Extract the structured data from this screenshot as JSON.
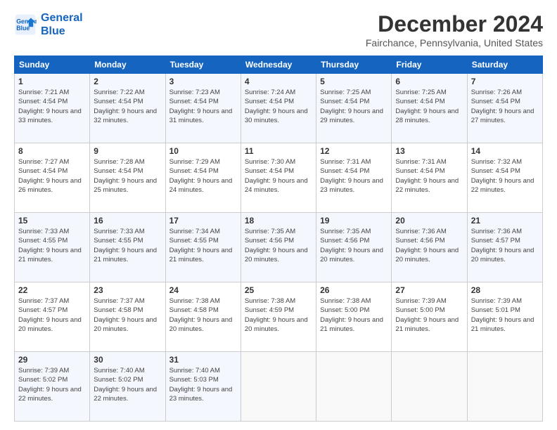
{
  "logo": {
    "line1": "General",
    "line2": "Blue"
  },
  "title": "December 2024",
  "subtitle": "Fairchance, Pennsylvania, United States",
  "days_of_week": [
    "Sunday",
    "Monday",
    "Tuesday",
    "Wednesday",
    "Thursday",
    "Friday",
    "Saturday"
  ],
  "weeks": [
    [
      {
        "day": "1",
        "sunrise": "Sunrise: 7:21 AM",
        "sunset": "Sunset: 4:54 PM",
        "daylight": "Daylight: 9 hours and 33 minutes."
      },
      {
        "day": "2",
        "sunrise": "Sunrise: 7:22 AM",
        "sunset": "Sunset: 4:54 PM",
        "daylight": "Daylight: 9 hours and 32 minutes."
      },
      {
        "day": "3",
        "sunrise": "Sunrise: 7:23 AM",
        "sunset": "Sunset: 4:54 PM",
        "daylight": "Daylight: 9 hours and 31 minutes."
      },
      {
        "day": "4",
        "sunrise": "Sunrise: 7:24 AM",
        "sunset": "Sunset: 4:54 PM",
        "daylight": "Daylight: 9 hours and 30 minutes."
      },
      {
        "day": "5",
        "sunrise": "Sunrise: 7:25 AM",
        "sunset": "Sunset: 4:54 PM",
        "daylight": "Daylight: 9 hours and 29 minutes."
      },
      {
        "day": "6",
        "sunrise": "Sunrise: 7:25 AM",
        "sunset": "Sunset: 4:54 PM",
        "daylight": "Daylight: 9 hours and 28 minutes."
      },
      {
        "day": "7",
        "sunrise": "Sunrise: 7:26 AM",
        "sunset": "Sunset: 4:54 PM",
        "daylight": "Daylight: 9 hours and 27 minutes."
      }
    ],
    [
      {
        "day": "8",
        "sunrise": "Sunrise: 7:27 AM",
        "sunset": "Sunset: 4:54 PM",
        "daylight": "Daylight: 9 hours and 26 minutes."
      },
      {
        "day": "9",
        "sunrise": "Sunrise: 7:28 AM",
        "sunset": "Sunset: 4:54 PM",
        "daylight": "Daylight: 9 hours and 25 minutes."
      },
      {
        "day": "10",
        "sunrise": "Sunrise: 7:29 AM",
        "sunset": "Sunset: 4:54 PM",
        "daylight": "Daylight: 9 hours and 24 minutes."
      },
      {
        "day": "11",
        "sunrise": "Sunrise: 7:30 AM",
        "sunset": "Sunset: 4:54 PM",
        "daylight": "Daylight: 9 hours and 24 minutes."
      },
      {
        "day": "12",
        "sunrise": "Sunrise: 7:31 AM",
        "sunset": "Sunset: 4:54 PM",
        "daylight": "Daylight: 9 hours and 23 minutes."
      },
      {
        "day": "13",
        "sunrise": "Sunrise: 7:31 AM",
        "sunset": "Sunset: 4:54 PM",
        "daylight": "Daylight: 9 hours and 22 minutes."
      },
      {
        "day": "14",
        "sunrise": "Sunrise: 7:32 AM",
        "sunset": "Sunset: 4:54 PM",
        "daylight": "Daylight: 9 hours and 22 minutes."
      }
    ],
    [
      {
        "day": "15",
        "sunrise": "Sunrise: 7:33 AM",
        "sunset": "Sunset: 4:55 PM",
        "daylight": "Daylight: 9 hours and 21 minutes."
      },
      {
        "day": "16",
        "sunrise": "Sunrise: 7:33 AM",
        "sunset": "Sunset: 4:55 PM",
        "daylight": "Daylight: 9 hours and 21 minutes."
      },
      {
        "day": "17",
        "sunrise": "Sunrise: 7:34 AM",
        "sunset": "Sunset: 4:55 PM",
        "daylight": "Daylight: 9 hours and 21 minutes."
      },
      {
        "day": "18",
        "sunrise": "Sunrise: 7:35 AM",
        "sunset": "Sunset: 4:56 PM",
        "daylight": "Daylight: 9 hours and 20 minutes."
      },
      {
        "day": "19",
        "sunrise": "Sunrise: 7:35 AM",
        "sunset": "Sunset: 4:56 PM",
        "daylight": "Daylight: 9 hours and 20 minutes."
      },
      {
        "day": "20",
        "sunrise": "Sunrise: 7:36 AM",
        "sunset": "Sunset: 4:56 PM",
        "daylight": "Daylight: 9 hours and 20 minutes."
      },
      {
        "day": "21",
        "sunrise": "Sunrise: 7:36 AM",
        "sunset": "Sunset: 4:57 PM",
        "daylight": "Daylight: 9 hours and 20 minutes."
      }
    ],
    [
      {
        "day": "22",
        "sunrise": "Sunrise: 7:37 AM",
        "sunset": "Sunset: 4:57 PM",
        "daylight": "Daylight: 9 hours and 20 minutes."
      },
      {
        "day": "23",
        "sunrise": "Sunrise: 7:37 AM",
        "sunset": "Sunset: 4:58 PM",
        "daylight": "Daylight: 9 hours and 20 minutes."
      },
      {
        "day": "24",
        "sunrise": "Sunrise: 7:38 AM",
        "sunset": "Sunset: 4:58 PM",
        "daylight": "Daylight: 9 hours and 20 minutes."
      },
      {
        "day": "25",
        "sunrise": "Sunrise: 7:38 AM",
        "sunset": "Sunset: 4:59 PM",
        "daylight": "Daylight: 9 hours and 20 minutes."
      },
      {
        "day": "26",
        "sunrise": "Sunrise: 7:38 AM",
        "sunset": "Sunset: 5:00 PM",
        "daylight": "Daylight: 9 hours and 21 minutes."
      },
      {
        "day": "27",
        "sunrise": "Sunrise: 7:39 AM",
        "sunset": "Sunset: 5:00 PM",
        "daylight": "Daylight: 9 hours and 21 minutes."
      },
      {
        "day": "28",
        "sunrise": "Sunrise: 7:39 AM",
        "sunset": "Sunset: 5:01 PM",
        "daylight": "Daylight: 9 hours and 21 minutes."
      }
    ],
    [
      {
        "day": "29",
        "sunrise": "Sunrise: 7:39 AM",
        "sunset": "Sunset: 5:02 PM",
        "daylight": "Daylight: 9 hours and 22 minutes."
      },
      {
        "day": "30",
        "sunrise": "Sunrise: 7:40 AM",
        "sunset": "Sunset: 5:02 PM",
        "daylight": "Daylight: 9 hours and 22 minutes."
      },
      {
        "day": "31",
        "sunrise": "Sunrise: 7:40 AM",
        "sunset": "Sunset: 5:03 PM",
        "daylight": "Daylight: 9 hours and 23 minutes."
      },
      null,
      null,
      null,
      null
    ]
  ]
}
